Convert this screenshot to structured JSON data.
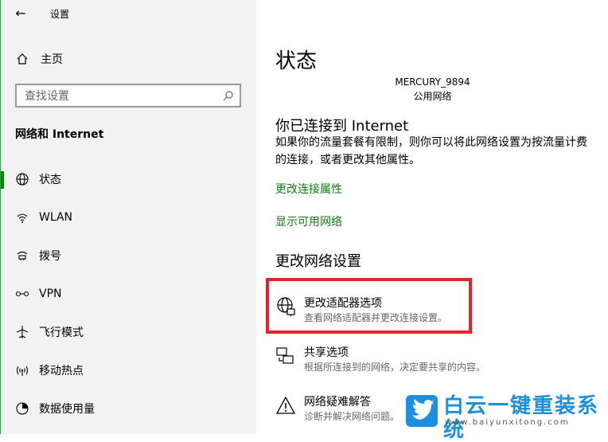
{
  "window": {
    "title": "设置",
    "back_glyph": "←"
  },
  "sidebar": {
    "home_label": "主页",
    "search_placeholder": "查找设置",
    "section_title": "网络和 Internet",
    "items": [
      {
        "label": "状态",
        "icon": "globe-icon",
        "active": true
      },
      {
        "label": "WLAN",
        "icon": "wifi-icon",
        "active": false
      },
      {
        "label": "拨号",
        "icon": "dialup-icon",
        "active": false
      },
      {
        "label": "VPN",
        "icon": "vpn-icon",
        "active": false
      },
      {
        "label": "飞行模式",
        "icon": "airplane-icon",
        "active": false
      },
      {
        "label": "移动热点",
        "icon": "hotspot-icon",
        "active": false
      },
      {
        "label": "数据使用量",
        "icon": "data-usage-icon",
        "active": false
      }
    ]
  },
  "main": {
    "heading": "状态",
    "network_name": "MERCURY_9894",
    "network_type": "公用网络",
    "connected_heading": "你已连接到 Internet",
    "connected_desc": "如果你的流量套餐有限制，则你可以将此网络设置为按流量计费的连接，或者更改其他属性。",
    "link_change_props": "更改连接属性",
    "link_show_networks": "显示可用网络",
    "change_heading": "更改网络设置",
    "options": [
      {
        "title": "更改适配器选项",
        "subtitle": "查看网络适配器并更改连接设置。",
        "icon": "adapter-icon"
      },
      {
        "title": "共享选项",
        "subtitle": "根据所连接到的网络，决定要共享的内容。",
        "icon": "sharing-icon"
      },
      {
        "title": "网络疑难解答",
        "subtitle": "诊断并解决网络问题。",
        "icon": "warning-icon"
      }
    ]
  },
  "watermark": {
    "title": "白云一键重装系统",
    "url": "www.baiyunxitong.com"
  },
  "colors": {
    "accent": "#107c10",
    "highlight": "#e0252b",
    "watermark": "#1d8fe0",
    "sidebar_bg": "#f2f2f2"
  }
}
